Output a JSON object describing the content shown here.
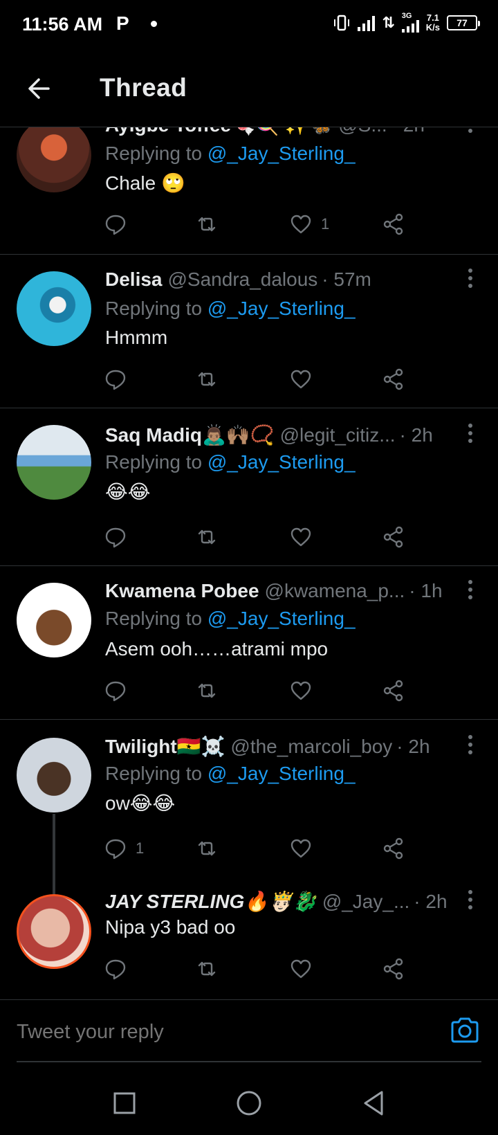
{
  "status_bar": {
    "time": "11:56 AM",
    "carrier_icon": "P",
    "network_type": "3G",
    "speed_value": "7.1",
    "speed_unit": "K/s",
    "battery": "77"
  },
  "header": {
    "title": "Thread"
  },
  "tweets": [
    {
      "name": "Ayigbe Toffee🍬🍭 ✨🦋",
      "handle": "@S...",
      "time": "· 2h",
      "replying_prefix": "Replying to ",
      "replying_to": "@_Jay_Sterling_",
      "text": "Chale 🙄",
      "reply_count": "",
      "retweet_count": "",
      "like_count": "1",
      "avatar_color": "#7a3b2a"
    },
    {
      "name": "Delisa",
      "handle": "@Sandra_dalous",
      "time": "· 57m",
      "replying_prefix": "Replying to ",
      "replying_to": "@_Jay_Sterling_",
      "text": "Hmmm",
      "reply_count": "",
      "retweet_count": "",
      "like_count": "",
      "avatar_color": "#2aa7c9"
    },
    {
      "name": "Saq Madiq🙇🏽‍♂️🙌🏽📿",
      "handle": "@legit_citiz...",
      "time": "· 2h",
      "replying_prefix": "Replying to ",
      "replying_to": "@_Jay_Sterling_",
      "text": "😂😂",
      "reply_count": "",
      "retweet_count": "",
      "like_count": "",
      "avatar_color": "#5f8f52"
    },
    {
      "name": "Kwamena Pobee",
      "handle": "@kwamena_p...",
      "time": "· 1h",
      "replying_prefix": "Replying to ",
      "replying_to": "@_Jay_Sterling_",
      "text": "Asem ooh……atrami mpo",
      "reply_count": "",
      "retweet_count": "",
      "like_count": "",
      "avatar_color": "#ffffff"
    },
    {
      "name": "Twilight🇬🇭☠️",
      "handle": "@the_marcoli_boy",
      "time": "· 2h",
      "replying_prefix": "Replying to ",
      "replying_to": "@_Jay_Sterling_",
      "text": "ow😂😂",
      "reply_count": "1",
      "retweet_count": "",
      "like_count": "",
      "avatar_color": "#c9d2dc"
    },
    {
      "name": "JAY STERLING🔥🤴🏻🐉",
      "handle": "@_Jay_...",
      "time": "· 2h",
      "replying_prefix": "",
      "replying_to": "",
      "text": "Nipa y3 bad oo",
      "reply_count": "",
      "retweet_count": "",
      "like_count": "",
      "avatar_color": "#e8b9a6"
    }
  ],
  "reply_box": {
    "placeholder": "Tweet your reply"
  },
  "colors": {
    "background": "#000000",
    "accent": "#1d9bf0",
    "muted": "#71767b",
    "divider": "#2f3336"
  }
}
